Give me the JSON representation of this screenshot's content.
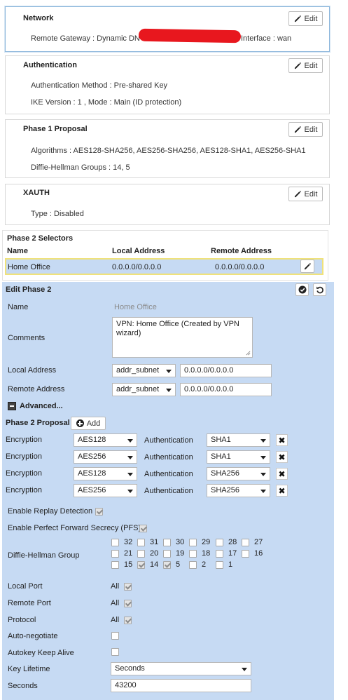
{
  "network": {
    "title": "Network",
    "edit_label": "Edit",
    "remote_gateway": "Remote Gateway : Dynamic DN",
    "interface": "Interface : wan"
  },
  "authentication": {
    "title": "Authentication",
    "edit_label": "Edit",
    "method": "Authentication Method : Pre-shared Key",
    "ike": "IKE Version : 1 , Mode : Main (ID protection)"
  },
  "phase1": {
    "title": "Phase 1 Proposal",
    "edit_label": "Edit",
    "algorithms": "Algorithms : AES128-SHA256, AES256-SHA256, AES128-SHA1, AES256-SHA1",
    "dh_groups": "Diffie-Hellman Groups : 14, 5"
  },
  "xauth": {
    "title": "XAUTH",
    "edit_label": "Edit",
    "type": "Type : Disabled"
  },
  "phase2_selectors": {
    "title": "Phase 2 Selectors",
    "columns": [
      "Name",
      "Local Address",
      "Remote Address"
    ],
    "row": {
      "name": "Home Office",
      "local": "0.0.0.0/0.0.0.0",
      "remote": "0.0.0.0/0.0.0.0"
    }
  },
  "edit_phase2": {
    "title": "Edit Phase 2",
    "name_label": "Name",
    "name_value": "Home Office",
    "comments_label": "Comments",
    "comments_value": "VPN: Home Office (Created by VPN wizard)",
    "local_address_label": "Local Address",
    "local_address_type": "addr_subnet",
    "local_address_value": "0.0.0.0/0.0.0.0",
    "remote_address_label": "Remote Address",
    "remote_address_type": "addr_subnet",
    "remote_address_value": "0.0.0.0/0.0.0.0",
    "advanced_label": "Advanced...",
    "proposal_label": "Phase 2 Proposal",
    "add_label": "Add",
    "proposals": [
      {
        "enc_label": "Encryption",
        "enc": "AES128",
        "auth_label": "Authentication",
        "auth": "SHA1"
      },
      {
        "enc_label": "Encryption",
        "enc": "AES256",
        "auth_label": "Authentication",
        "auth": "SHA1"
      },
      {
        "enc_label": "Encryption",
        "enc": "AES128",
        "auth_label": "Authentication",
        "auth": "SHA256"
      },
      {
        "enc_label": "Encryption",
        "enc": "AES256",
        "auth_label": "Authentication",
        "auth": "SHA256"
      }
    ],
    "replay_label": "Enable Replay Detection",
    "pfs_label": "Enable Perfect Forward Secrecy (PFS)",
    "dh_label": "Diffie-Hellman Group",
    "dh_groups": [
      {
        "num": "32",
        "checked": false
      },
      {
        "num": "31",
        "checked": false
      },
      {
        "num": "30",
        "checked": false
      },
      {
        "num": "29",
        "checked": false
      },
      {
        "num": "28",
        "checked": false
      },
      {
        "num": "27",
        "checked": false
      },
      {
        "num": "21",
        "checked": false
      },
      {
        "num": "20",
        "checked": false
      },
      {
        "num": "19",
        "checked": false
      },
      {
        "num": "18",
        "checked": false
      },
      {
        "num": "17",
        "checked": false
      },
      {
        "num": "16",
        "checked": false
      },
      {
        "num": "15",
        "checked": false
      },
      {
        "num": "14",
        "checked": true
      },
      {
        "num": "5",
        "checked": true
      },
      {
        "num": "2",
        "checked": false
      },
      {
        "num": "1",
        "checked": false
      }
    ],
    "local_port_label": "Local Port",
    "local_port_value": "All",
    "remote_port_label": "Remote Port",
    "remote_port_value": "All",
    "protocol_label": "Protocol",
    "protocol_value": "All",
    "autonegotiate_label": "Auto-negotiate",
    "keepalive_label": "Autokey Keep Alive",
    "key_lifetime_label": "Key Lifetime",
    "key_lifetime_value": "Seconds",
    "seconds_label": "Seconds",
    "seconds_value": "43200"
  },
  "colors": {
    "panel_bg": "#c6daf3",
    "selected_row_border": "#f0e27a",
    "redaction": "#e8171e"
  }
}
